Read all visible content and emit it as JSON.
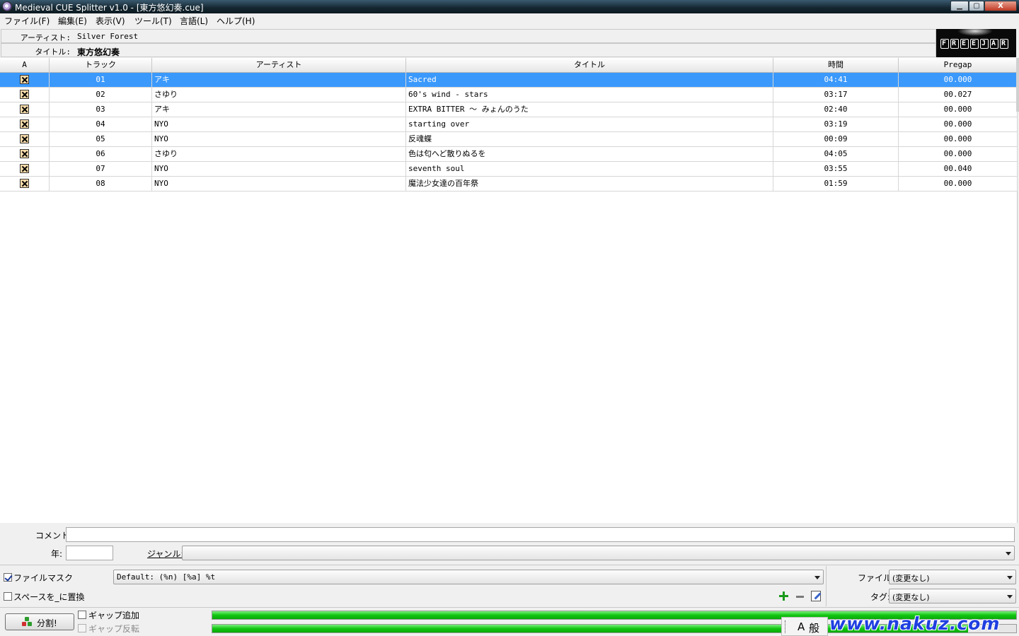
{
  "window": {
    "title": "Medieval CUE Splitter v1.0 - [東方悠幻奏.cue]",
    "minimize_glyph": "▁",
    "maximize_glyph": "▢",
    "close_glyph": "X"
  },
  "menu": [
    {
      "label": "ファイル(F)"
    },
    {
      "label": "編集(E)"
    },
    {
      "label": "表示(V)"
    },
    {
      "label": "ツール(T)"
    },
    {
      "label": "言語(L)"
    },
    {
      "label": "ヘルプ(H)"
    }
  ],
  "album": {
    "artist_label": "アーティスト:",
    "artist": "Silver Forest",
    "title_label": "タイトル:",
    "title": "東方悠幻奏"
  },
  "logo": {
    "letters": [
      "F",
      "R",
      "E",
      "E",
      "J",
      "A",
      "R"
    ]
  },
  "table": {
    "headers": {
      "a": "A",
      "track": "トラック",
      "artist": "アーティスト",
      "title": "タイトル",
      "time": "時間",
      "pregap": "Pregap"
    },
    "rows": [
      {
        "track": "01",
        "artist": "アキ",
        "title": "Sacred",
        "time": "04:41",
        "pregap": "00.000",
        "selected": true
      },
      {
        "track": "02",
        "artist": "さゆり",
        "title": "60's wind - stars",
        "time": "03:17",
        "pregap": "00.027"
      },
      {
        "track": "03",
        "artist": "アキ",
        "title": "EXTRA BITTER 〜 みょんのうた",
        "time": "02:40",
        "pregap": "00.000"
      },
      {
        "track": "04",
        "artist": "NYO",
        "title": "starting over",
        "time": "03:19",
        "pregap": "00.000"
      },
      {
        "track": "05",
        "artist": "NYO",
        "title": "反魂蝶",
        "time": "00:09",
        "pregap": "00.000"
      },
      {
        "track": "06",
        "artist": "さゆり",
        "title": "色は匂へど散りぬるを",
        "time": "04:05",
        "pregap": "00.000"
      },
      {
        "track": "07",
        "artist": "NYO",
        "title": "seventh soul",
        "time": "03:55",
        "pregap": "00.040"
      },
      {
        "track": "08",
        "artist": "NYO",
        "title": "魔法少女達の百年祭",
        "time": "01:59",
        "pregap": "00.000"
      }
    ]
  },
  "meta": {
    "comment_label": "コメント:",
    "comment_value": "",
    "year_label": "年:",
    "year_value": "",
    "genre_label": "ジャンル:",
    "genre_value": ""
  },
  "options": {
    "file_mask_label": "ファイルマスク",
    "file_mask_checked": true,
    "file_mask_value": "Default: (%n) [%a] %t",
    "replace_space_label": "スペースを_に置換",
    "replace_space_checked": false,
    "file_label": "ファイル:",
    "file_value": "(変更なし)",
    "tag_label": "タグ:",
    "tag_value": "(変更なし)"
  },
  "actions": {
    "split_label": "分割!",
    "add_gap_label": "ギャップ追加",
    "reverse_gap_label": "ギャップ反転"
  },
  "progress": {
    "bar1": 1.0,
    "bar2": 0.94
  },
  "ime": {
    "a": "A",
    "mode": "般"
  },
  "watermark": "www.nakuz.com",
  "colors": {
    "selection": "#3b99fc",
    "progress": "#11c611"
  },
  "icons": [
    "app-icon",
    "checkbox-x-icon",
    "add-icon",
    "remove-icon",
    "edit-icon",
    "split-icon",
    "dropdown-arrow-icon"
  ]
}
